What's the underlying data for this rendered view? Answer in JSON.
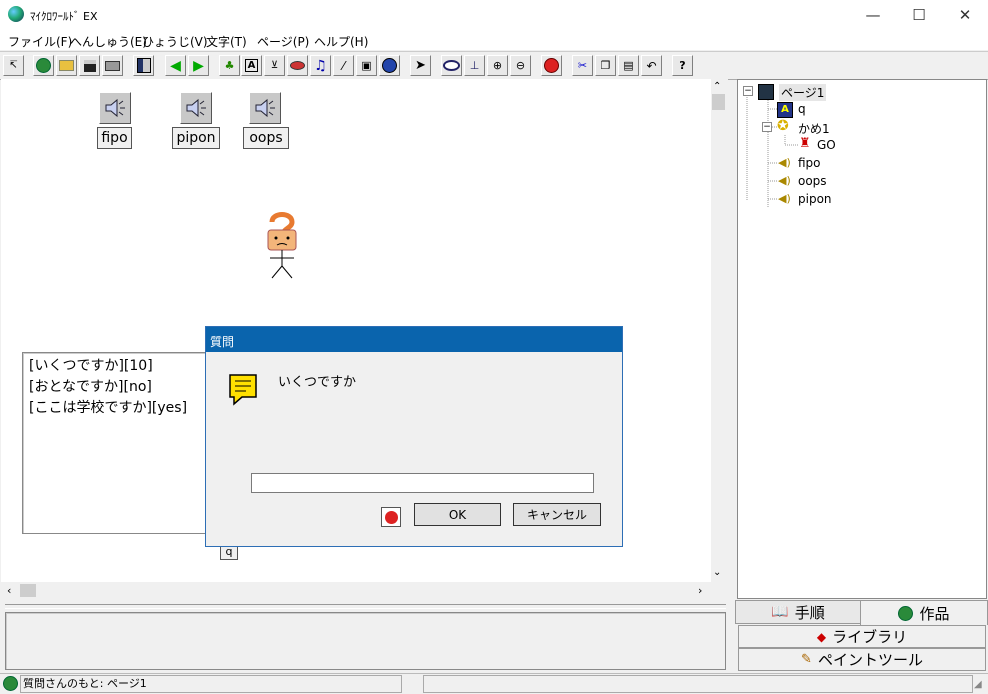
{
  "window": {
    "title": "ﾏｲｸﾛﾜｰﾙﾄﾞ EX",
    "minimize": "—",
    "maximize": "☐",
    "close": "✕"
  },
  "menu": [
    "ファイル(F)",
    "へんしゅう(E)",
    "ひょうじ(V)",
    "文字(T)",
    "ページ(P)",
    "ヘルプ(H)"
  ],
  "toolbar": {
    "help_label": "?",
    "text_tool_label": "A"
  },
  "canvas": {
    "sound_objects": [
      "fipo",
      "pipon",
      "oops"
    ],
    "text_lines": [
      "[いくつですか][10]",
      "[おとなですか][no]",
      "[ここは学校ですか][yes]"
    ],
    "q_tag": "q"
  },
  "dialog": {
    "title": "質問",
    "prompt": "いくつですか",
    "input_value": "",
    "ok_label": "OK",
    "cancel_label": "キャンセル"
  },
  "tree": {
    "root": "ページ1",
    "items": {
      "q": "q",
      "kame": "かめ1",
      "go": "GO",
      "fipo": "fipo",
      "oops": "oops",
      "pipon": "pipon"
    }
  },
  "tabs": {
    "procedure": "手順",
    "works": "作品",
    "library": "ライブラリ",
    "paint": "ペイントツール"
  },
  "status": {
    "text": "質問さんのもと: ページ1"
  }
}
